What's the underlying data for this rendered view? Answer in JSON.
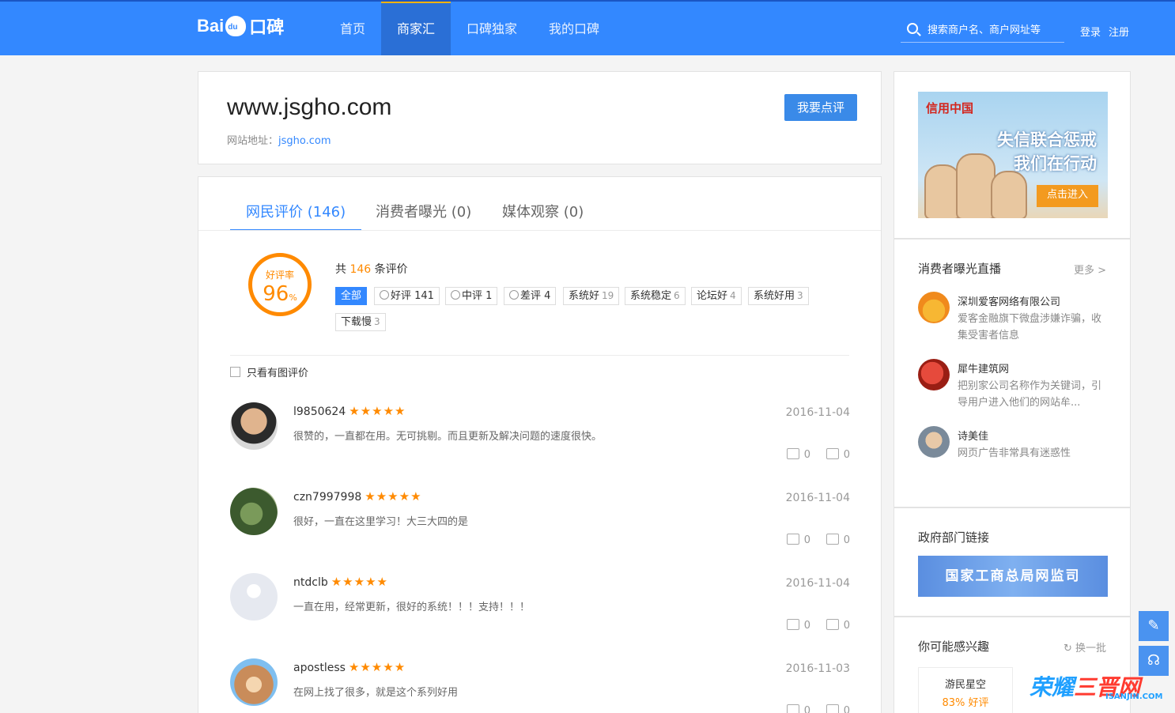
{
  "brand": {
    "logo_text": "Bai",
    "logo_paw": "du",
    "logo_suffix": "口碑"
  },
  "nav": {
    "items": [
      "首页",
      "商家汇",
      "口碑独家",
      "我的口碑"
    ],
    "active": "商家汇"
  },
  "search": {
    "placeholder": "搜索商户名、商户网址等"
  },
  "auth": {
    "login": "登录",
    "register": "注册"
  },
  "site": {
    "title": "www.jsgho.com",
    "url_label": "网站地址：",
    "url": "jsgho.com",
    "review_button": "我要点评"
  },
  "tabs": [
    {
      "label": "网民评价",
      "count": "(146)"
    },
    {
      "label": "消费者曝光",
      "count": "(0)"
    },
    {
      "label": "媒体观察",
      "count": "(0)"
    }
  ],
  "rating": {
    "label": "好评率",
    "value": "96",
    "unit": "%",
    "total_prefix": "共",
    "total": "146",
    "total_suffix": "条评价"
  },
  "tags": [
    {
      "label": "全部",
      "count": ""
    },
    {
      "label": "好评 141",
      "count": ""
    },
    {
      "label": "中评 1",
      "count": ""
    },
    {
      "label": "差评 4",
      "count": ""
    },
    {
      "label": "系统好",
      "count": "19"
    },
    {
      "label": "系统稳定",
      "count": "6"
    },
    {
      "label": "论坛好",
      "count": "4"
    },
    {
      "label": "系统好用",
      "count": "3"
    },
    {
      "label": "下载慢",
      "count": "3"
    }
  ],
  "filter": {
    "only_pics": "只看有图评价"
  },
  "stars": "★★★★★",
  "reviews": [
    {
      "user": "l9850624",
      "text": "很赞的，一直都在用。无可挑剔。而且更新及解决问题的速度很快。",
      "date": "2016-11-04",
      "likes": "0",
      "comments": "0"
    },
    {
      "user": "czn7997998",
      "text": "很好，一直在这里学习！大三大四的是",
      "date": "2016-11-04",
      "likes": "0",
      "comments": "0"
    },
    {
      "user": "ntdclb",
      "text": "一直在用，经常更新，很好的系统！！！支持！！！",
      "date": "2016-11-04",
      "likes": "0",
      "comments": "0"
    },
    {
      "user": "apostless",
      "text": "在网上找了很多，就是这个系列好用",
      "date": "2016-11-03",
      "likes": "0",
      "comments": "0"
    }
  ],
  "sidebar": {
    "banner": {
      "brand": "信用中国",
      "line1": "失信联合惩戒",
      "line2": "我们在行动",
      "button": "点击进入"
    },
    "exposure_title": "消费者曝光直播",
    "more": "更多 >",
    "exposures": [
      {
        "name": "深圳爱客网络有限公司",
        "desc": "爱客金融旗下微盘涉嫌诈骗，收集受害者信息"
      },
      {
        "name": "犀牛建筑网",
        "desc": "把别家公司名称作为关键词，引导用户进入他们的网站牟..."
      },
      {
        "name": "诗美佳",
        "desc": "网页广告非常具有迷惑性"
      }
    ],
    "gov_title": "政府部门链接",
    "gov_banner": "国家工商总局网监司",
    "interest_title": "你可能感兴趣",
    "refresh": "换一批",
    "interest": [
      {
        "name": "游民星空",
        "rate": "83% 好评"
      }
    ]
  },
  "watermark": {
    "a": "荣耀",
    "b": "三晋网",
    "url": "ISANJIN.COM"
  }
}
